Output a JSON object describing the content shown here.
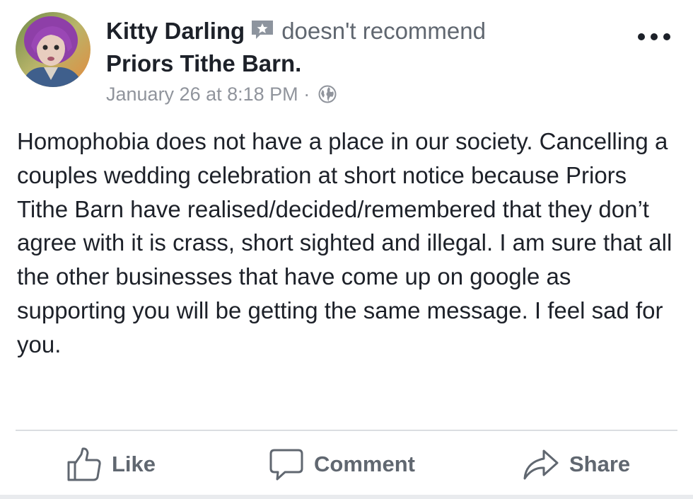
{
  "post": {
    "author": "Kitty Darling",
    "recommendation_text": "doesn't recommend",
    "page_name": "Priors Tithe Barn.",
    "timestamp": "January 26 at 8:18 PM",
    "separator": "·",
    "privacy_icon": "globe-icon",
    "more_icon": "more-options-icon",
    "recommendation_icon": "recommendation-flag-icon",
    "body": "Homophobia does not have a place in our society. Cancelling a couples wedding celebration at short notice because Priors Tithe Barn have realised/decided/remembered that they don’t agree with it is crass, short sighted and illegal. I am sure that all the other businesses that have come up on google as supporting you will be getting the same message. I feel sad for you."
  },
  "actions": {
    "like": {
      "label": "Like",
      "icon": "thumbs-up-icon"
    },
    "comment": {
      "label": "Comment",
      "icon": "speech-bubble-icon"
    },
    "share": {
      "label": "Share",
      "icon": "share-arrow-icon"
    }
  },
  "colors": {
    "text_primary": "#1d2129",
    "text_secondary": "#606770",
    "text_meta": "#90949c",
    "divider": "#dadde1"
  }
}
